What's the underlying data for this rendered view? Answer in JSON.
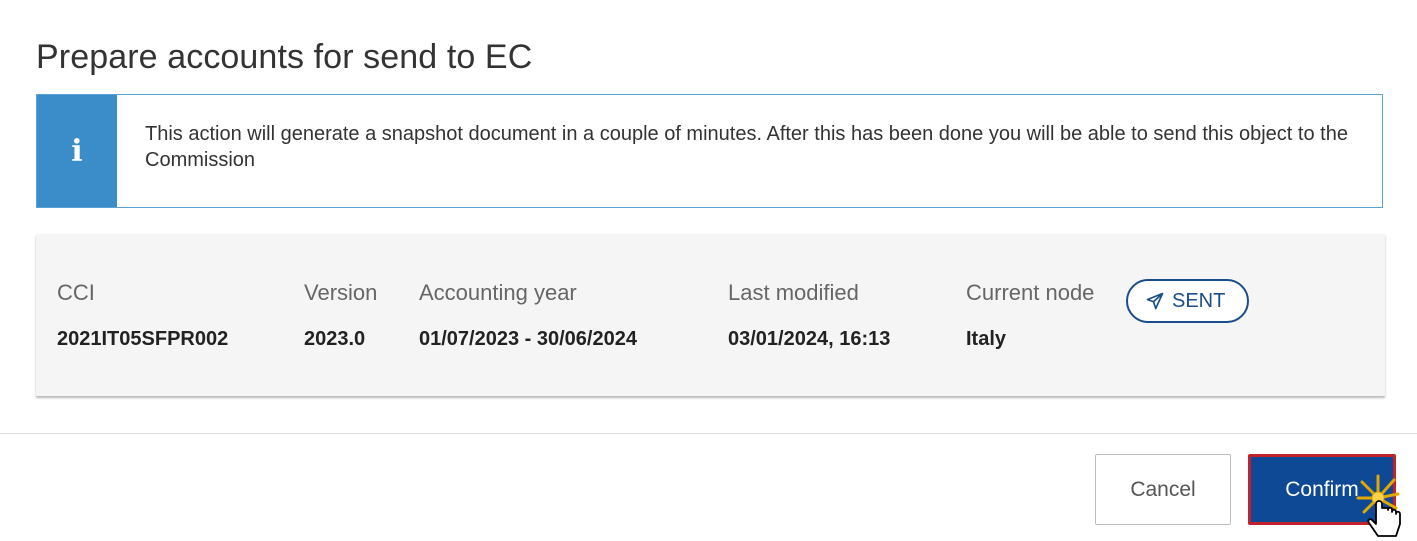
{
  "dialog": {
    "title": "Prepare accounts for send to EC"
  },
  "info": {
    "icon": "info-icon",
    "icon_glyph": "i",
    "message": "This action will generate a snapshot document in a couple of minutes. After this has been done you will be able to send this object to the Commission"
  },
  "summary": {
    "cci": {
      "label": "CCI",
      "value": "2021IT05SFPR002"
    },
    "version": {
      "label": "Version",
      "value": "2023.0"
    },
    "accounting_year": {
      "label": "Accounting year",
      "value": "01/07/2023 - 30/06/2024"
    },
    "last_modified": {
      "label": "Last modified",
      "value": "03/01/2024, 16:13"
    },
    "current_node": {
      "label": "Current node",
      "value": "Italy"
    },
    "status_badge": {
      "label": "SENT",
      "icon": "paper-plane-icon"
    }
  },
  "buttons": {
    "cancel_label": "Cancel",
    "confirm_label": "Confirm"
  },
  "colors": {
    "info_accent": "#3a8dc9",
    "primary": "#0d4994",
    "focus_border": "#c0212b",
    "badge": "#1a4d8a"
  }
}
